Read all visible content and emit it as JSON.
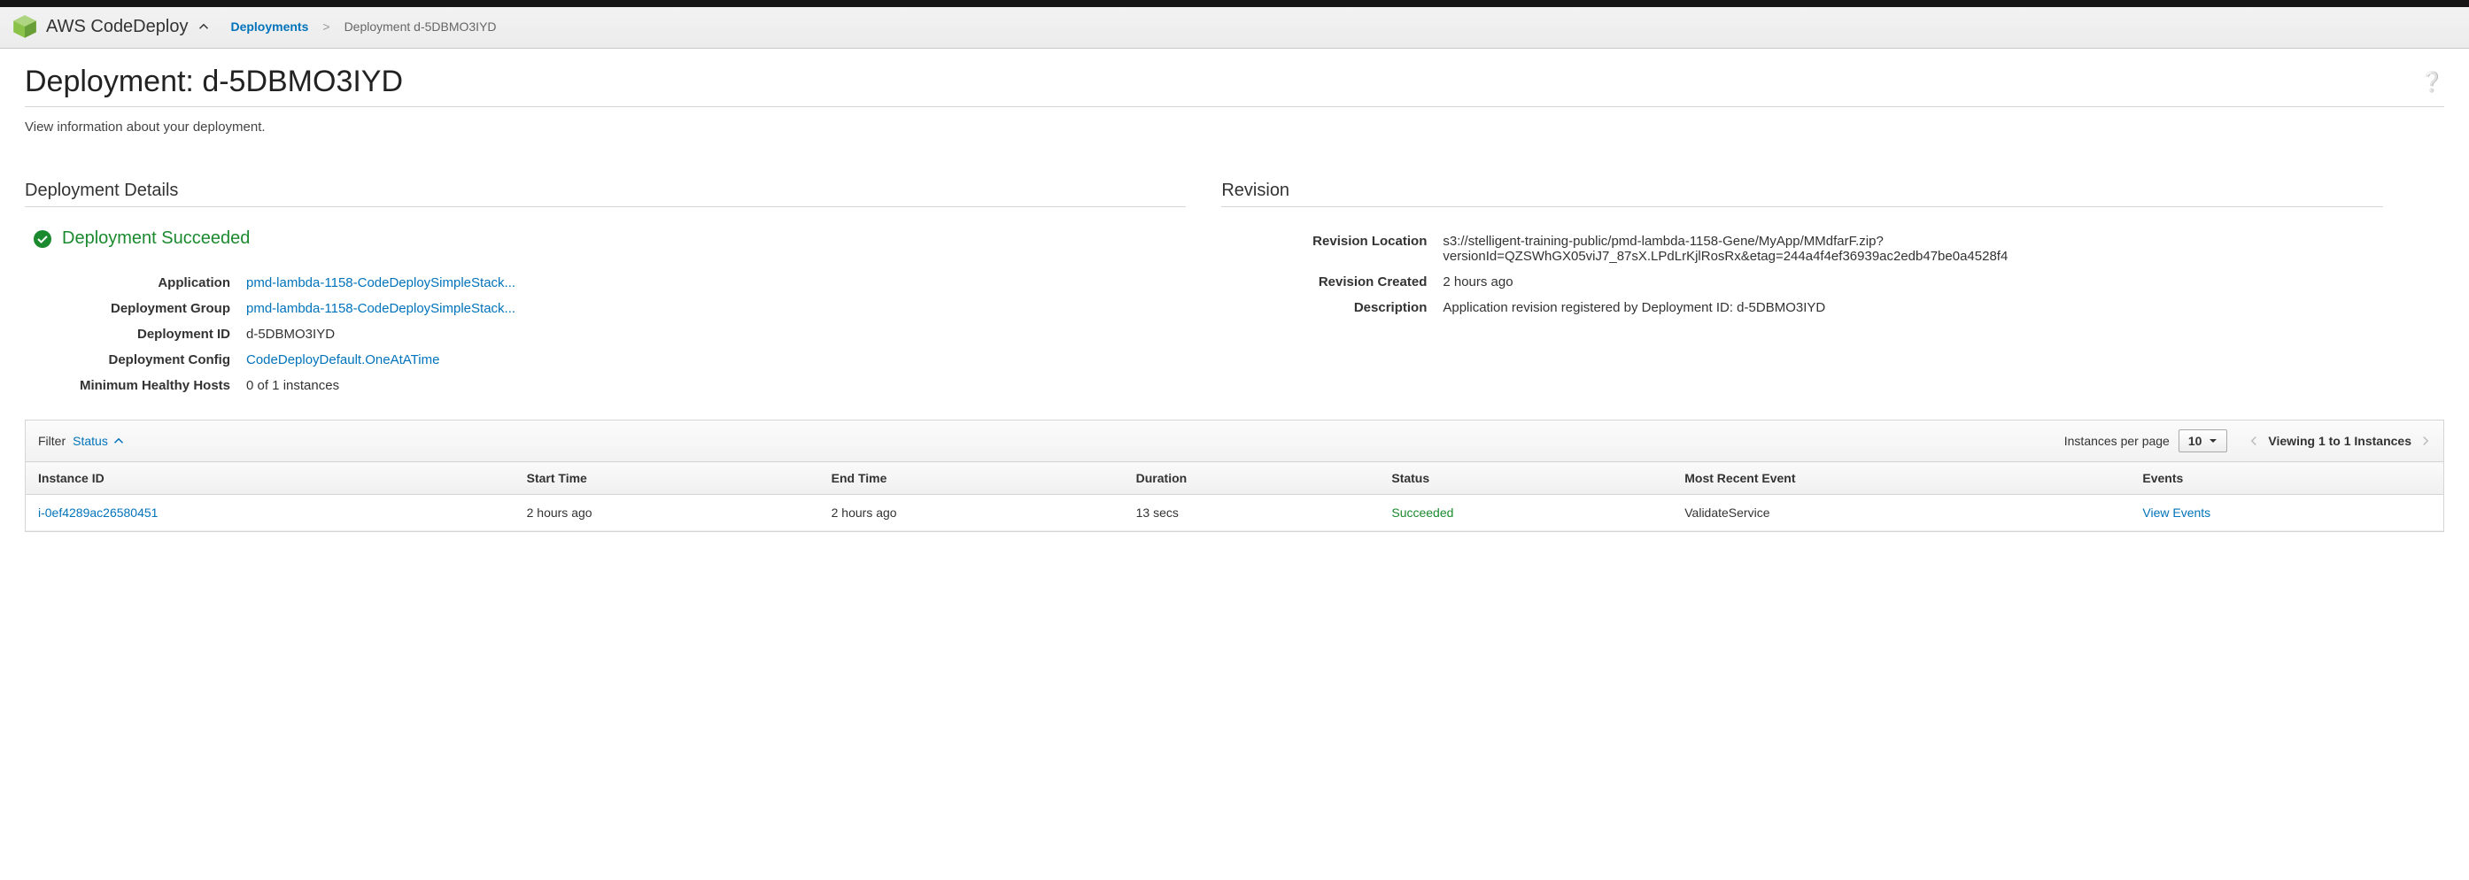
{
  "header": {
    "service_name": "AWS CodeDeploy",
    "breadcrumb_link": "Deployments",
    "breadcrumb_current": "Deployment d-5DBMO3IYD"
  },
  "page": {
    "title": "Deployment: d-5DBMO3IYD",
    "subtitle": "View information about your deployment."
  },
  "details": {
    "heading": "Deployment Details",
    "status_text": "Deployment Succeeded",
    "labels": {
      "application": "Application",
      "deployment_group": "Deployment Group",
      "deployment_id": "Deployment ID",
      "deployment_config": "Deployment Config",
      "min_healthy_hosts": "Minimum Healthy Hosts"
    },
    "values": {
      "application": "pmd-lambda-1158-CodeDeploySimpleStack...",
      "deployment_group": "pmd-lambda-1158-CodeDeploySimpleStack...",
      "deployment_id": "d-5DBMO3IYD",
      "deployment_config": "CodeDeployDefault.OneAtATime",
      "min_healthy_hosts": "0 of 1 instances"
    }
  },
  "revision": {
    "heading": "Revision",
    "labels": {
      "location": "Revision Location",
      "created": "Revision Created",
      "description": "Description"
    },
    "values": {
      "location": "s3://stelligent-training-public/pmd-lambda-1158-Gene/MyApp/MMdfarF.zip?versionId=QZSWhGX05viJ7_87sX.LPdLrKjlRosRx&etag=244a4f4ef36939ac2edb47be0a4528f4",
      "created": "2 hours ago",
      "description": "Application revision registered by Deployment ID: d-5DBMO3IYD"
    }
  },
  "instances": {
    "filter_label": "Filter",
    "filter_field": "Status",
    "ipp_label": "Instances per page",
    "ipp_value": "10",
    "pager_text": "Viewing 1 to 1 Instances",
    "columns": {
      "instance_id": "Instance ID",
      "start_time": "Start Time",
      "end_time": "End Time",
      "duration": "Duration",
      "status": "Status",
      "most_recent_event": "Most Recent Event",
      "events": "Events"
    },
    "row": {
      "instance_id": "i-0ef4289ac26580451",
      "start_time": "2 hours ago",
      "end_time": "2 hours ago",
      "duration": "13 secs",
      "status": "Succeeded",
      "most_recent_event": "ValidateService",
      "events_link": "View Events"
    }
  }
}
